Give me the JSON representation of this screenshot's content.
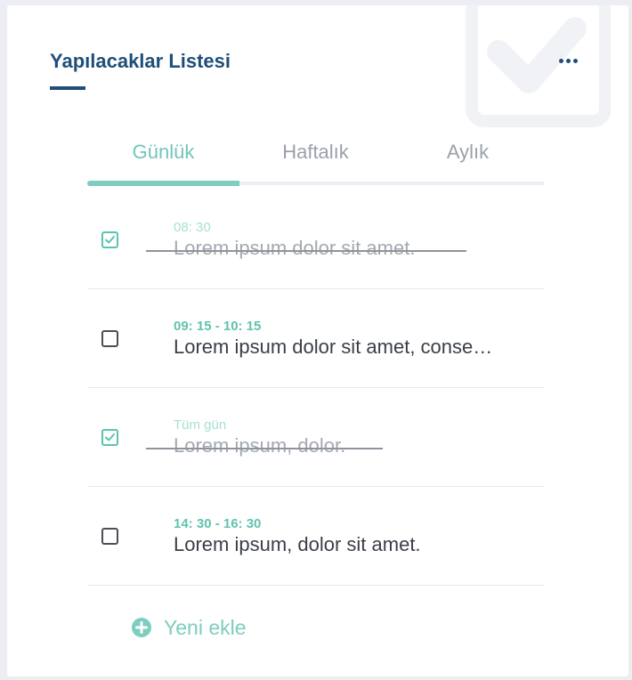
{
  "card": {
    "title": "Yapılacaklar Listesi",
    "more_icon": "more-horizontal-icon"
  },
  "tabs": [
    {
      "label": "Günlük",
      "active": true
    },
    {
      "label": "Haftalık",
      "active": false
    },
    {
      "label": "Aylık",
      "active": false
    }
  ],
  "todos": [
    {
      "time": "08: 30",
      "text": "Lorem ipsum dolor sit amet.",
      "done": true
    },
    {
      "time": "09: 15 - 10: 15",
      "text": "Lorem ipsum dolor sit amet, conse…",
      "done": false
    },
    {
      "time": "Tüm gün",
      "text": "Lorem ipsum, dolor.",
      "done": true
    },
    {
      "time": "14: 30 - 16: 30",
      "text": "Lorem ipsum, dolor sit amet.",
      "done": false
    }
  ],
  "add": {
    "label": "Yeni ekle",
    "icon": "plus-circle-icon"
  },
  "colors": {
    "title": "#1f4e79",
    "accent": "#7ecdbf",
    "check": "#5bc4b0",
    "time": "#5fc3ae",
    "text": "#3a3f47"
  }
}
